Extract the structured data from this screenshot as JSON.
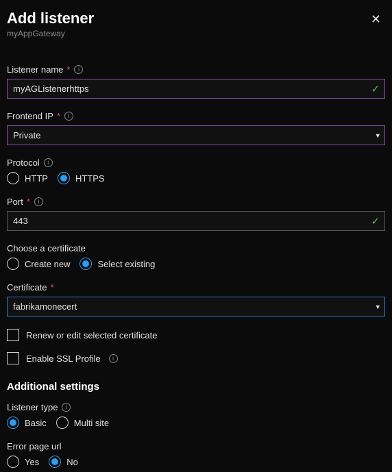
{
  "header": {
    "title": "Add listener",
    "subtitle": "myAppGateway"
  },
  "listenerName": {
    "label": "Listener name",
    "value": "myAGListenerhttps"
  },
  "frontendIp": {
    "label": "Frontend IP",
    "value": "Private"
  },
  "protocol": {
    "label": "Protocol",
    "options": {
      "http": "HTTP",
      "https": "HTTPS"
    }
  },
  "port": {
    "label": "Port",
    "value": "443"
  },
  "chooseCert": {
    "label": "Choose a certificate",
    "options": {
      "createNew": "Create new",
      "selectExisting": "Select existing"
    }
  },
  "certificate": {
    "label": "Certificate",
    "value": "fabrikamonecert"
  },
  "renewCert": {
    "label": "Renew or edit selected certificate"
  },
  "enableSsl": {
    "label": "Enable SSL Profile"
  },
  "additional": {
    "heading": "Additional settings",
    "listenerType": {
      "label": "Listener type",
      "options": {
        "basic": "Basic",
        "multiSite": "Multi site"
      }
    },
    "errorPage": {
      "label": "Error page url",
      "options": {
        "yes": "Yes",
        "no": "No"
      }
    }
  }
}
